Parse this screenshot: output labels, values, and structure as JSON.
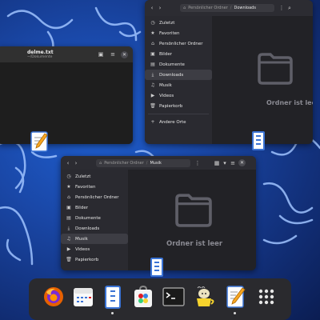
{
  "colors": {
    "accent": "#3b74d6",
    "wallpaper": "#1a48a8",
    "window_bg": "#222226",
    "sidebar_bg": "#2a2a30",
    "dock_bg": "#2a2a2e"
  },
  "editor": {
    "title": "delme.txt",
    "subtitle": "~/Dokumente"
  },
  "downloads_window": {
    "path": [
      "Persönlicher Ordner",
      "Downloads"
    ],
    "sidebar": [
      {
        "icon": "clock-icon",
        "glyph": "◷",
        "label": "Zuletzt"
      },
      {
        "icon": "star-icon",
        "glyph": "★",
        "label": "Favoriten"
      },
      {
        "icon": "home-icon",
        "glyph": "⌂",
        "label": "Persönlicher Ordner"
      },
      {
        "icon": "image-icon",
        "glyph": "▣",
        "label": "Bilder"
      },
      {
        "icon": "document-icon",
        "glyph": "▤",
        "label": "Dokumente"
      },
      {
        "icon": "download-icon",
        "glyph": "⤓",
        "label": "Downloads"
      },
      {
        "icon": "music-icon",
        "glyph": "♫",
        "label": "Musik"
      },
      {
        "icon": "video-icon",
        "glyph": "▶",
        "label": "Videos"
      },
      {
        "icon": "trash-icon",
        "glyph": "🗑",
        "label": "Papierkorb"
      },
      {
        "icon": "plus-icon",
        "glyph": "+",
        "label": "Andere Orte"
      }
    ],
    "active": "Downloads",
    "empty_text": "Ordner ist leer"
  },
  "music_window": {
    "path": [
      "Persönlicher Ordner",
      "Musik"
    ],
    "sidebar": [
      {
        "icon": "clock-icon",
        "glyph": "◷",
        "label": "Zuletzt"
      },
      {
        "icon": "star-icon",
        "glyph": "★",
        "label": "Favoriten"
      },
      {
        "icon": "home-icon",
        "glyph": "⌂",
        "label": "Persönlicher Ordner"
      },
      {
        "icon": "image-icon",
        "glyph": "▣",
        "label": "Bilder"
      },
      {
        "icon": "document-icon",
        "glyph": "▤",
        "label": "Dokumente"
      },
      {
        "icon": "download-icon",
        "glyph": "⤓",
        "label": "Downloads"
      },
      {
        "icon": "music-icon",
        "glyph": "♫",
        "label": "Musik"
      },
      {
        "icon": "video-icon",
        "glyph": "▶",
        "label": "Videos"
      },
      {
        "icon": "trash-icon",
        "glyph": "🗑",
        "label": "Papierkorb"
      }
    ],
    "active": "Musik",
    "empty_text": "Ordner ist leer"
  },
  "dock": [
    {
      "name": "firefox",
      "running": false
    },
    {
      "name": "calendar",
      "running": false
    },
    {
      "name": "files",
      "running": true
    },
    {
      "name": "software",
      "running": false
    },
    {
      "name": "terminal",
      "running": false
    },
    {
      "name": "tea-cup",
      "running": false
    },
    {
      "name": "text-editor",
      "running": true
    },
    {
      "name": "app-grid",
      "running": false
    }
  ]
}
